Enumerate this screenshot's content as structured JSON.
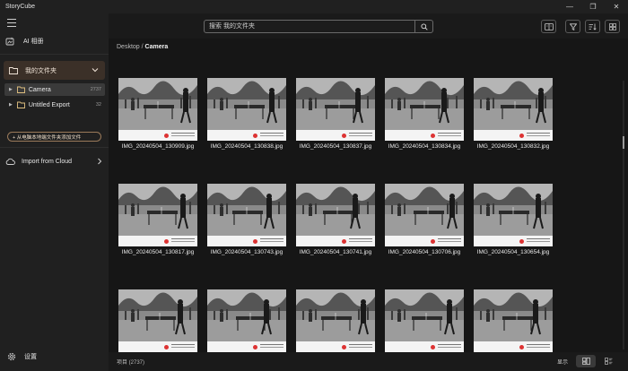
{
  "app": {
    "title": "StoryCube"
  },
  "window_controls": [
    "—",
    "❐",
    "✕"
  ],
  "sidebar": {
    "ai_label": "AI 相册",
    "my_folders_label": "我的文件夹",
    "folders": [
      {
        "name": "Camera",
        "count": "2737",
        "selected": true
      },
      {
        "name": "Untitled Export",
        "count": "32",
        "selected": false
      }
    ],
    "add_folder_label": "+ 从电脑本地端文件夹添加文件",
    "import_cloud_label": "Import from Cloud",
    "settings_label": "设置"
  },
  "toolbar": {
    "search_placeholder": "搜索 我的文件夹",
    "icons": [
      "compare-icon",
      "filter-icon",
      "sort-icon",
      "grid-view-icon"
    ]
  },
  "breadcrumb": {
    "parent": "Desktop",
    "separator": " / ",
    "current": "Camera"
  },
  "photos": [
    {
      "name": "IMG_20240504_130909.jpg"
    },
    {
      "name": "IMG_20240504_130838.jpg"
    },
    {
      "name": "IMG_20240504_130837.jpg"
    },
    {
      "name": "IMG_20240504_130834.jpg"
    },
    {
      "name": "IMG_20240504_130832.jpg"
    },
    {
      "name": "IMG_20240504_130817.jpg"
    },
    {
      "name": "IMG_20240504_130743.jpg"
    },
    {
      "name": "IMG_20240504_130741.jpg"
    },
    {
      "name": "IMG_20240504_130706.jpg"
    },
    {
      "name": "IMG_20240504_130654.jpg"
    },
    {
      "name": ""
    },
    {
      "name": ""
    },
    {
      "name": ""
    },
    {
      "name": ""
    },
    {
      "name": ""
    }
  ],
  "status": {
    "items_label": "项目 (2737)",
    "show_label": "显示"
  },
  "colors": {
    "accent": "#3b3028",
    "accent_border": "#9a7a5a",
    "background": "#161616"
  }
}
